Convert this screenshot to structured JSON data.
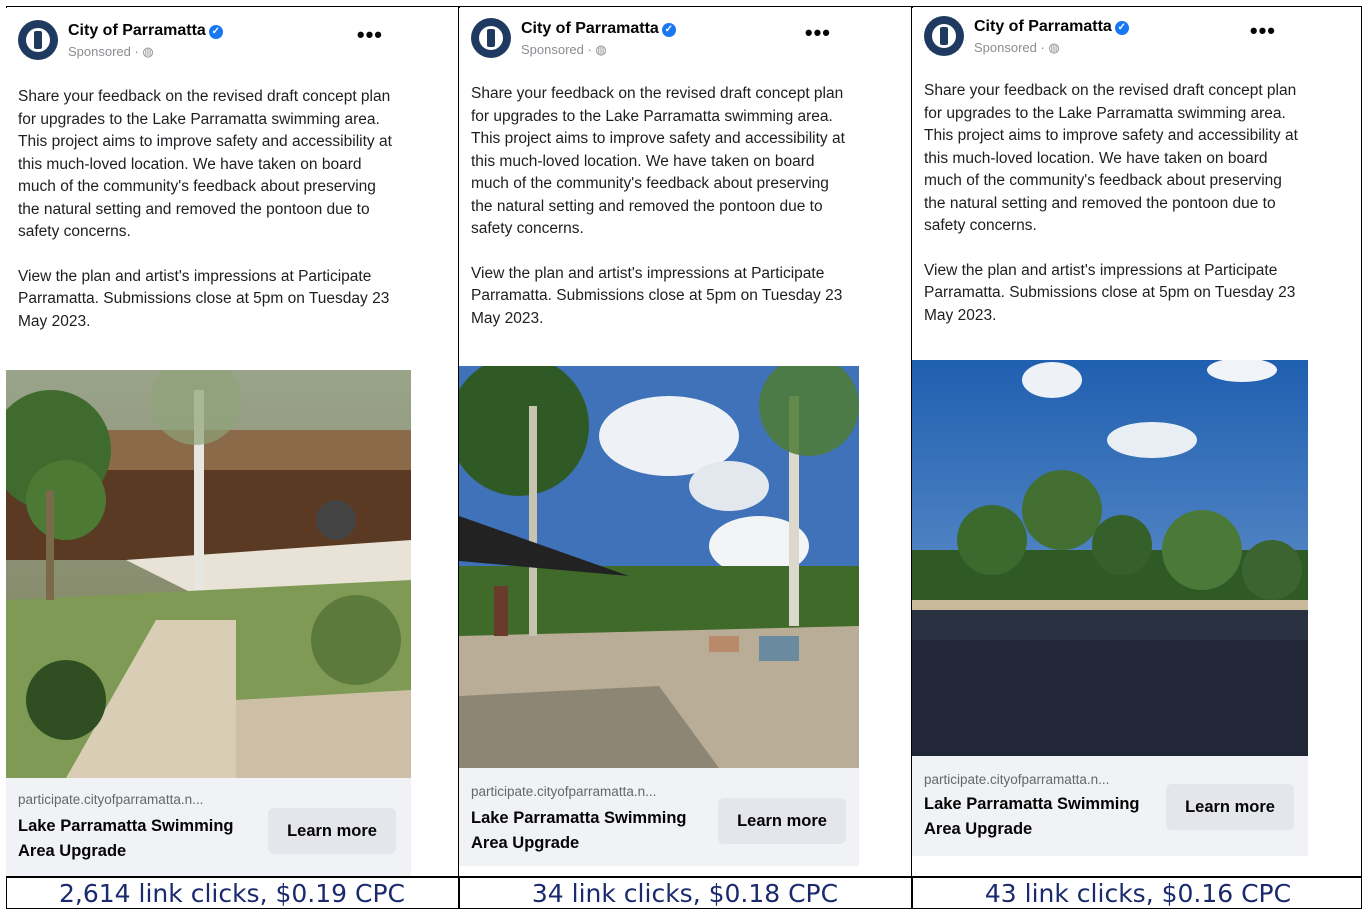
{
  "ads": [
    {
      "page_name": "City of Parramatta",
      "sponsored": "Sponsored · ◍",
      "body_p1": "Share your feedback on the revised draft concept plan for upgrades to the Lake Parramatta swimming area. This project aims to improve safety and accessibility at this much-loved location. We have taken on board much of the community's feedback about preserving the natural setting and removed the pontoon due to safety concerns.",
      "body_p2": "View the plan and artist's impressions at Participate Parramatta. Submissions close at 5pm on Tuesday 23 May 2023.",
      "domain": "participate.cityofparramatta.n...",
      "headline": "Lake Parramatta Swimming Area Upgrade",
      "cta": "Learn more",
      "caption": "2,614 link clicks, $0.19 CPC"
    },
    {
      "page_name": "City of Parramatta",
      "sponsored": "Sponsored · ◍",
      "body_p1": "Share your feedback on the revised draft concept plan for upgrades to the Lake Parramatta swimming area. This project aims to improve safety and accessibility at this much-loved location. We have taken on board much of the community's feedback about preserving the natural setting and removed the pontoon due to safety concerns.",
      "body_p2": "View the plan and artist's impressions at Participate Parramatta. Submissions close at 5pm on Tuesday 23 May 2023.",
      "domain": "participate.cityofparramatta.n...",
      "headline": "Lake Parramatta Swimming Area Upgrade",
      "cta": "Learn more",
      "caption": "34 link clicks, $0.18 CPC"
    },
    {
      "page_name": "City of Parramatta",
      "sponsored": "Sponsored · ◍",
      "body_p1": "Share your feedback on the revised draft concept plan for upgrades to the Lake Parramatta swimming area. This project aims to improve safety and accessibility at this much-loved location. We have taken on board much of the community's feedback about preserving the natural setting and removed the pontoon due to safety concerns.",
      "body_p2": "View the plan and artist's impressions at Participate Parramatta. Submissions close at 5pm on Tuesday 23 May 2023.",
      "domain": "participate.cityofparramatta.n...",
      "headline": "Lake Parramatta Swimming Area Upgrade",
      "cta": "Learn more",
      "caption": "43 link clicks, $0.16 CPC"
    }
  ],
  "icons": {
    "verified": "verified-badge-icon",
    "more": "more-options-icon",
    "logo": "city-of-parramatta-logo"
  },
  "colors": {
    "verified_blue": "#1877f2",
    "caption_navy": "#1a2a6c",
    "footer_gray": "#f0f2f5",
    "button_gray": "#e4e6eb"
  }
}
